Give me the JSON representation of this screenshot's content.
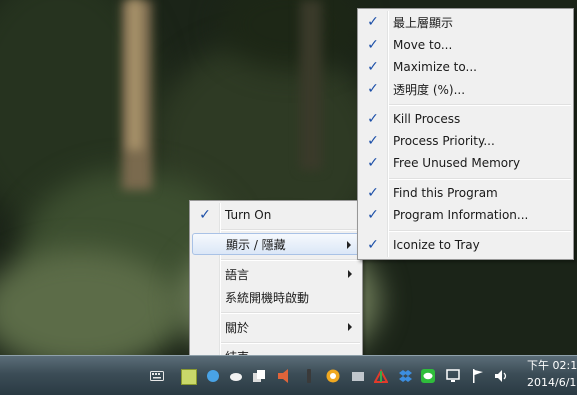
{
  "context_menu": {
    "items": [
      {
        "label": "Turn On",
        "checked": true
      },
      {
        "label": "顯示 / 隱藏",
        "submenu": true
      },
      {
        "label": "語言",
        "submenu": true
      },
      {
        "label": "系統開機時啟動"
      },
      {
        "label": "關於",
        "submenu": true
      },
      {
        "label": "結束"
      }
    ]
  },
  "submenu": {
    "items": [
      {
        "label": "最上層顯示",
        "checked": true
      },
      {
        "label": "Move to...",
        "checked": true
      },
      {
        "label": "Maximize to...",
        "checked": true
      },
      {
        "label": "透明度 (%)...",
        "checked": true
      },
      {
        "label": "Kill Process",
        "checked": true
      },
      {
        "label": "Process Priority...",
        "checked": true
      },
      {
        "label": "Free Unused Memory",
        "checked": true
      },
      {
        "label": "Find this Program",
        "checked": true
      },
      {
        "label": "Program Information...",
        "checked": true
      },
      {
        "label": "Iconize to Tray",
        "checked": true
      }
    ]
  },
  "check_glyph": "✓",
  "taskbar": {
    "clock": {
      "time": "下午 02:1",
      "date": "2014/6/1"
    },
    "tray_icons": [
      "keyboard-icon",
      "app-tray-icon",
      "chat-bubble-icon",
      "cloud-icon",
      "copy-icon",
      "speaker-app-icon",
      "power-icon",
      "clock-app-icon",
      "network-icon",
      "dropbox-icon",
      "line-icon",
      "desktop-icon",
      "flag-icon",
      "volume-icon"
    ]
  },
  "colors": {
    "check": "#1c4fa8",
    "highlight_border": "#a9c2e6",
    "menu_bg": "#f0f0f0",
    "taskbar": "#3c4d57"
  }
}
